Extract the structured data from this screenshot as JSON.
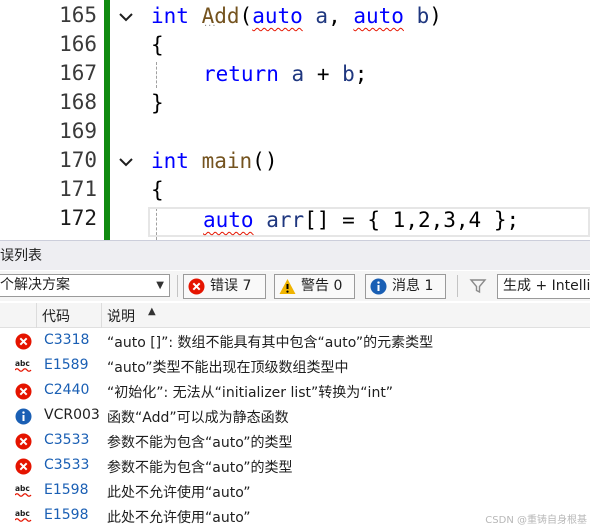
{
  "editor": {
    "line_numbers": [
      "165",
      "166",
      "167",
      "168",
      "169",
      "170",
      "171",
      "172"
    ],
    "lines": [
      {
        "tokens": [
          {
            "t": "int",
            "c": "kw"
          },
          {
            "t": " "
          },
          {
            "t": "Add",
            "c": "fn"
          },
          {
            "t": "("
          },
          {
            "t": "auto",
            "c": "kw squig"
          },
          {
            "t": " "
          },
          {
            "t": "a",
            "c": "id"
          },
          {
            "t": ", "
          },
          {
            "t": "auto",
            "c": "kw squig"
          },
          {
            "t": " "
          },
          {
            "t": "b",
            "c": "id"
          },
          {
            "t": ")"
          }
        ]
      },
      {
        "tokens": [
          {
            "t": "{"
          }
        ]
      },
      {
        "tokens": [
          {
            "t": "return",
            "c": "kw"
          },
          {
            "t": " "
          },
          {
            "t": "a",
            "c": "id"
          },
          {
            "t": " + "
          },
          {
            "t": "b",
            "c": "id"
          },
          {
            "t": ";"
          }
        ]
      },
      {
        "tokens": [
          {
            "t": "}"
          }
        ]
      },
      {
        "tokens": []
      },
      {
        "tokens": [
          {
            "t": "int",
            "c": "kw"
          },
          {
            "t": " "
          },
          {
            "t": "main",
            "c": "fn"
          },
          {
            "t": "()"
          }
        ]
      },
      {
        "tokens": [
          {
            "t": "{"
          }
        ]
      },
      {
        "tokens": [
          {
            "t": "auto",
            "c": "kw squig"
          },
          {
            "t": " "
          },
          {
            "t": "arr",
            "c": "id"
          },
          {
            "t": "[] = { 1,2,3,4 };"
          }
        ]
      }
    ]
  },
  "error_list": {
    "title": "误列表",
    "scope": "个解决方案",
    "filters": {
      "errors": "错误 7",
      "warnings": "警告 0",
      "messages": "消息 1"
    },
    "build_source": "生成 + IntelliSense",
    "columns": {
      "code": "代码",
      "description": "说明"
    },
    "rows": [
      {
        "type": "error",
        "code": "C3318",
        "description": "“auto []”: 数组不能具有其中包含“auto”的元素类型"
      },
      {
        "type": "intellisense",
        "code": "E1589",
        "description": "“auto”类型不能出现在顶级数组类型中"
      },
      {
        "type": "error",
        "code": "C2440",
        "description": "“初始化”: 无法从“initializer list”转换为“int”"
      },
      {
        "type": "info",
        "code": "VCR003",
        "description": "函数“Add”可以成为静态函数"
      },
      {
        "type": "error",
        "code": "C3533",
        "description": "参数不能为包含“auto”的类型"
      },
      {
        "type": "error",
        "code": "C3533",
        "description": "参数不能为包含“auto”的类型"
      },
      {
        "type": "intellisense",
        "code": "E1598",
        "description": "此处不允许使用“auto”"
      },
      {
        "type": "intellisense",
        "code": "E1598",
        "description": "此处不允许使用“auto”"
      }
    ]
  },
  "watermark": "CSDN @重铸自身根基",
  "colors": {
    "error": "#e51400",
    "warning": "#f0b400",
    "info": "#1a5fb4",
    "change_bar": "#108a10"
  }
}
